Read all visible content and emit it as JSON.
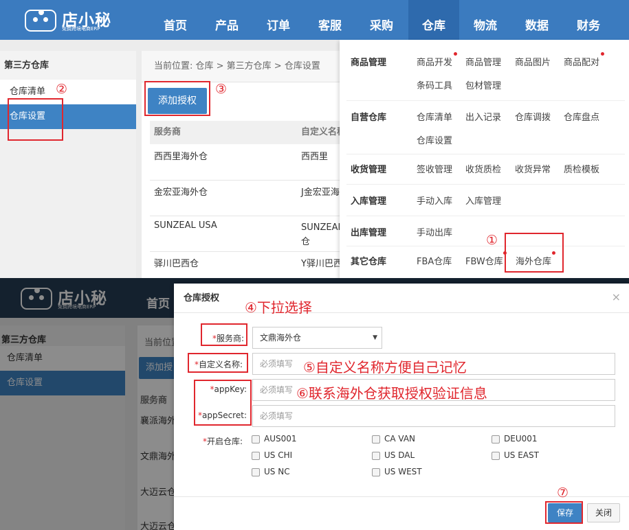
{
  "app": {
    "logo_name": "店小秘",
    "logo_sub": "免费跨境电商ERP",
    "nav": [
      "首页",
      "产品",
      "订单",
      "客服",
      "采购",
      "仓库",
      "物流",
      "数据",
      "财务"
    ]
  },
  "sidebar": {
    "title": "第三方仓库",
    "items": [
      "仓库清单",
      "仓库设置"
    ]
  },
  "breadcrumb": "当前位置:  仓库 > 第三方仓库 > 仓库设置",
  "add_auth_label": "添加授权",
  "table": {
    "headers": [
      "服务商",
      "自定义名称"
    ],
    "rows": [
      [
        "西西里海外仓",
        "西西里"
      ],
      [
        "金宏亚海外仓",
        "J金宏亚海"
      ],
      [
        "SUNZEAL USA",
        "SUNZEAL 仓"
      ],
      [
        "驿川巴西仓",
        "Y驿川巴西"
      ]
    ]
  },
  "mega_menu": [
    {
      "title": "商品管理",
      "links": [
        "商品开发",
        "商品管理",
        "商品图片",
        "商品配对",
        "条码工具",
        "包材管理"
      ]
    },
    {
      "title": "自营仓库",
      "links": [
        "仓库清单",
        "出入记录",
        "仓库调拨",
        "仓库盘点",
        "仓库设置"
      ]
    },
    {
      "title": "收货管理",
      "links": [
        "签收管理",
        "收货质检",
        "收货异常",
        "质检模板"
      ]
    },
    {
      "title": "入库管理",
      "links": [
        "手动入库",
        "入库管理"
      ]
    },
    {
      "title": "出库管理",
      "links": [
        "手动出库"
      ]
    },
    {
      "title": "其它仓库",
      "links": [
        "FBA仓库",
        "FBW仓库",
        "海外仓库"
      ]
    }
  ],
  "background_page": {
    "nav_home": "首页",
    "breadcrumb_prefix": "当前位置",
    "add_auth_partial": "添加授",
    "table_header": "服务商",
    "rows": [
      "襄派海外",
      "文鼎海外",
      "大迈云仓",
      "大迈云仓"
    ]
  },
  "modal": {
    "title": "仓库授权",
    "close": "×",
    "provider_label": "服务商:",
    "provider_value": "文鼎海外仓",
    "custom_name_label": "自定义名称:",
    "custom_name_placeholder": "必须填写",
    "appkey_label": "appKey:",
    "appkey_placeholder": "必须填写",
    "appsecret_label": "appSecret:",
    "appsecret_placeholder": "必须填写",
    "warehouses_label": "开启仓库:",
    "warehouses": [
      "AUS001",
      "CA VAN",
      "DEU001",
      "US CHI",
      "US DAL",
      "US EAST",
      "US NC",
      "US WEST"
    ],
    "save": "保存",
    "close_button": "关闭"
  },
  "annotations": {
    "step1": "①",
    "step2": "②",
    "step3": "③",
    "step4": "④下拉选择",
    "step5": "⑤自定义名称方便自己记忆",
    "step6": "⑥联系海外仓获取授权验证信息",
    "step7": "⑦"
  },
  "colors": {
    "nav_blue": "#3b7bbf",
    "selected_blue": "#3e83c4",
    "annotation_red": "#e0262d",
    "nav_dark": "#263c54"
  }
}
